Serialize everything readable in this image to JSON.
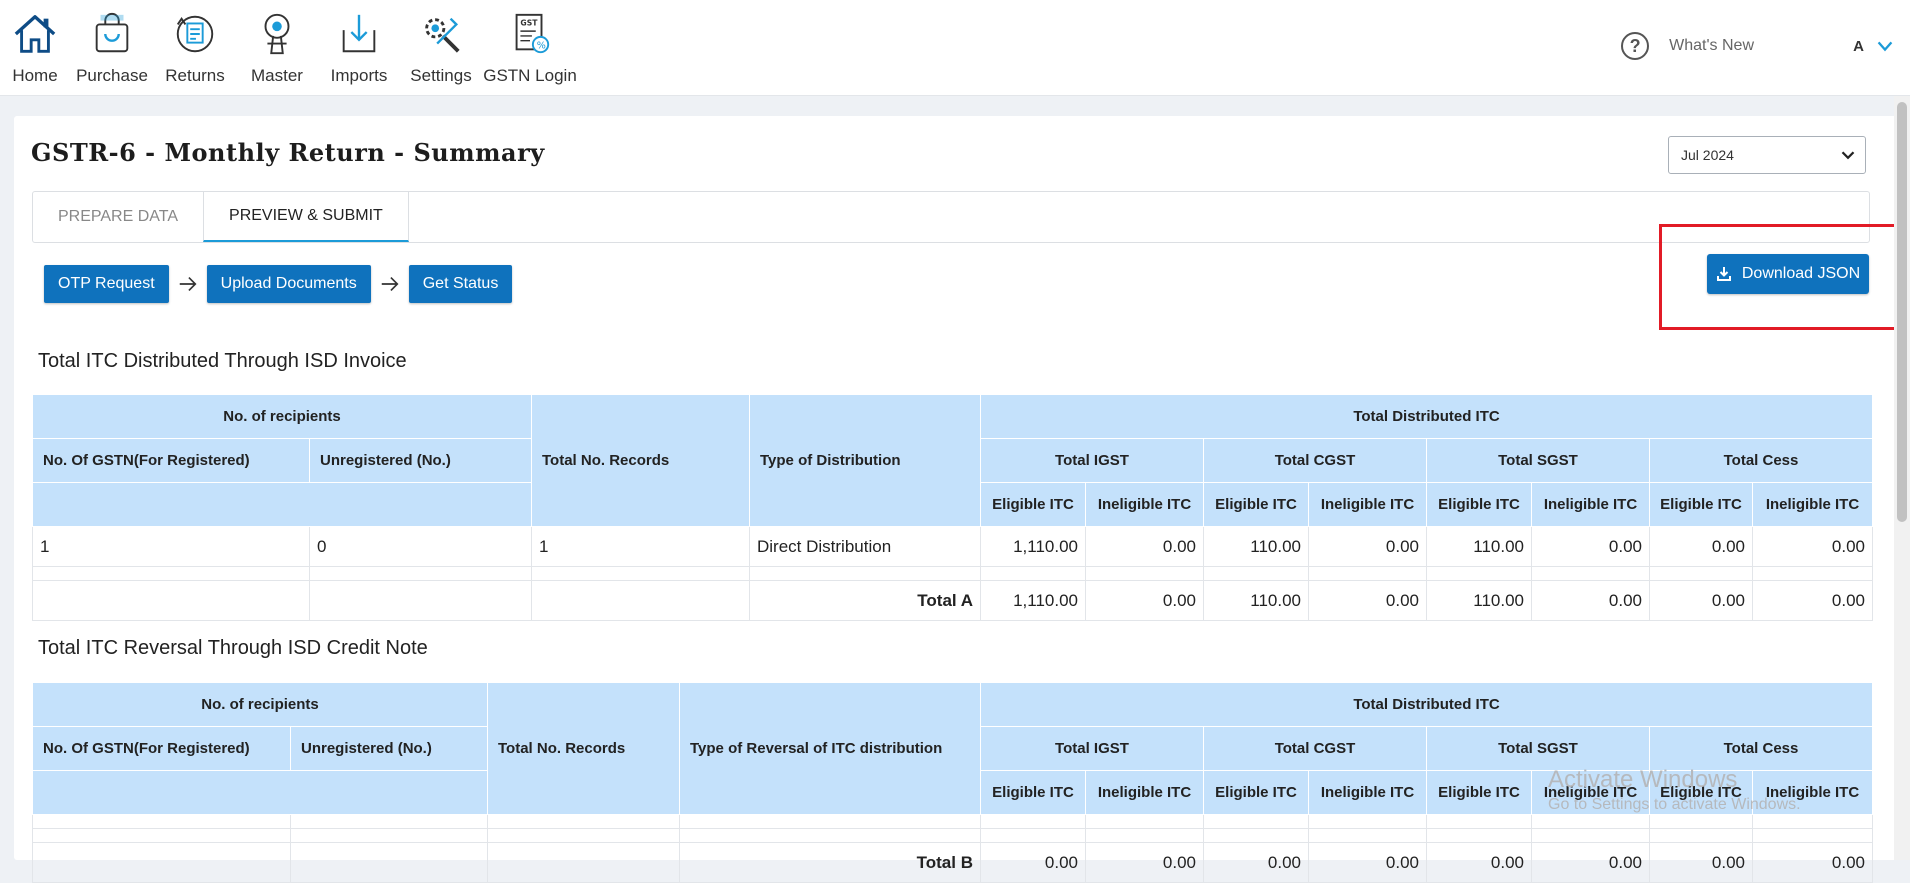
{
  "nav": {
    "items": [
      {
        "label": "Home",
        "icon": "home-icon"
      },
      {
        "label": "Purchase",
        "icon": "shopping-bag-icon"
      },
      {
        "label": "Returns",
        "icon": "returns-icon"
      },
      {
        "label": "Master",
        "icon": "master-icon"
      },
      {
        "label": "Imports",
        "icon": "import-icon"
      },
      {
        "label": "Settings",
        "icon": "settings-icon"
      },
      {
        "label": "GSTN Login",
        "icon": "gst-login-icon"
      }
    ],
    "help_icon": "?",
    "whats_new": "What's New",
    "user_initial": "A"
  },
  "page": {
    "title": "GSTR-6 - Monthly Return - Summary",
    "period_selected": "Jul 2024"
  },
  "tabs": [
    {
      "label": "PREPARE DATA",
      "active": false
    },
    {
      "label": "PREVIEW & SUBMIT",
      "active": true
    }
  ],
  "steps": {
    "otp": "OTP Request",
    "upload": "Upload Documents",
    "status": "Get Status"
  },
  "download_button": "Download JSON",
  "headers": {
    "no_recipients": "No. of recipients",
    "no_gstn": "No. Of GSTN(For Registered)",
    "unregistered": "Unregistered (No.)",
    "total_records": "Total No. Records",
    "type_distribution": "Type of Distribution",
    "type_reversal": "Type of Reversal of ITC distribution",
    "total_distributed": "Total Distributed ITC",
    "total_igst": "Total IGST",
    "total_cgst": "Total CGST",
    "total_sgst": "Total SGST",
    "total_cess": "Total Cess",
    "eligible": "Eligible ITC",
    "ineligible": "Ineligible ITC"
  },
  "section_a": {
    "title": "Total ITC Distributed Through ISD Invoice",
    "row": {
      "gstn": "1",
      "unregistered": "0",
      "records": "1",
      "type": "Direct Distribution",
      "igst_e": "1,110.00",
      "igst_i": "0.00",
      "cgst_e": "110.00",
      "cgst_i": "0.00",
      "sgst_e": "110.00",
      "sgst_i": "0.00",
      "cess_e": "0.00",
      "cess_i": "0.00"
    },
    "total": {
      "label": "Total A",
      "igst_e": "1,110.00",
      "igst_i": "0.00",
      "cgst_e": "110.00",
      "cgst_i": "0.00",
      "sgst_e": "110.00",
      "sgst_i": "0.00",
      "cess_e": "0.00",
      "cess_i": "0.00"
    }
  },
  "section_b": {
    "title": "Total ITC Reversal Through ISD Credit Note",
    "total": {
      "label": "Total B",
      "igst_e": "0.00",
      "igst_i": "0.00",
      "cgst_e": "0.00",
      "cgst_i": "0.00",
      "sgst_e": "0.00",
      "sgst_i": "0.00",
      "cess_e": "0.00",
      "cess_i": "0.00"
    }
  },
  "watermark": {
    "line1": "Activate Windows",
    "line2": "Go to Settings to activate Windows."
  },
  "colors": {
    "primary": "#0f72bd",
    "header_bg": "#c4e1fb",
    "highlight": "#e21b26"
  }
}
